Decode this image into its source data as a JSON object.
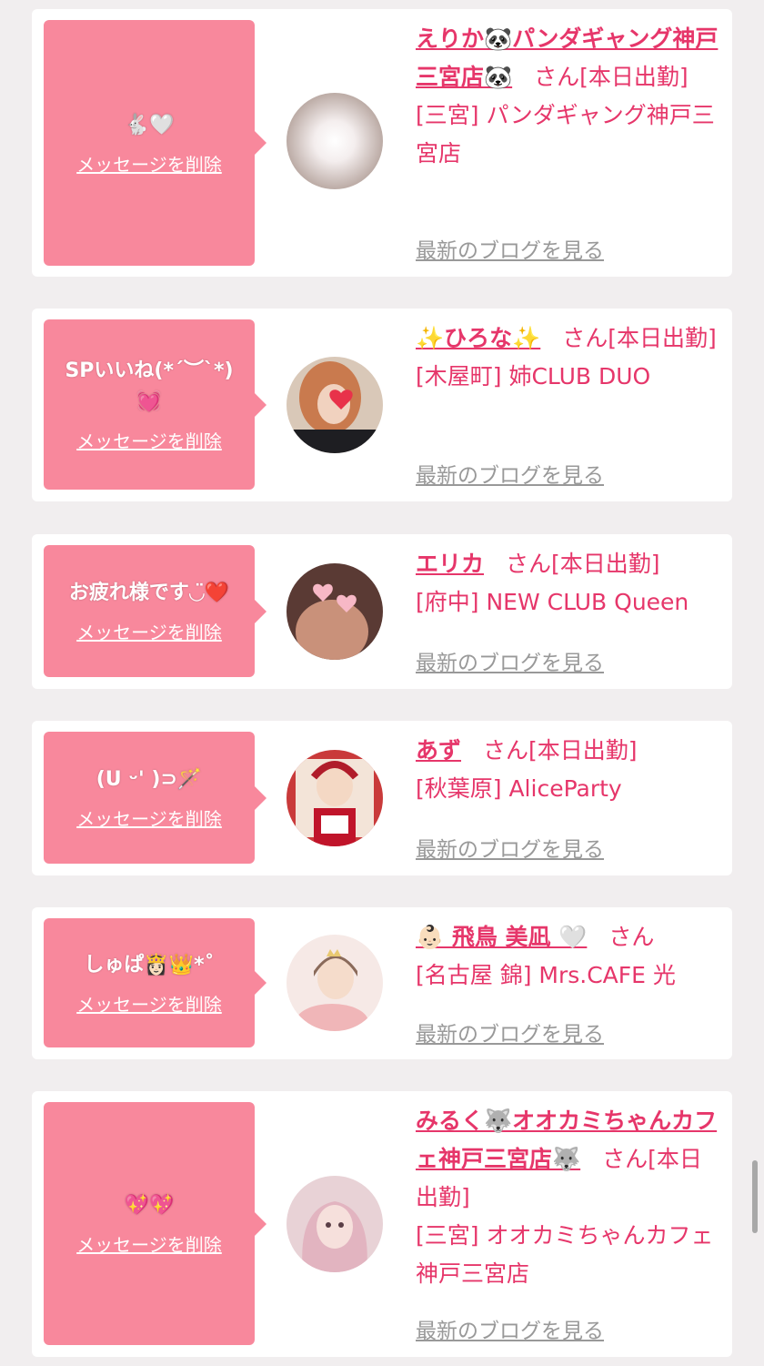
{
  "delete_label": "メッセージを削除",
  "blog_label": "最新のブログを見る",
  "colors": {
    "bubble": "#f8889c",
    "name": "#e6366a",
    "link": "#999999",
    "background": "#f1eeef"
  },
  "cards": [
    {
      "message": "🐇🤍",
      "name": "えりか🐼パンダギャング神戸三宮店🐼",
      "san": "さん",
      "status": "[本日出勤]",
      "shop": "[三宮] パンダギャング神戸三宮店",
      "avatar": "avatar-photo-1"
    },
    {
      "message": "SPいいね(*´︶`*)💓",
      "name": "✨ひろな✨",
      "san": "さん",
      "status": "[本日出勤]",
      "shop": "[木屋町] 姉CLUB DUO",
      "avatar": "avatar-photo-2"
    },
    {
      "message": "お疲れ様です◡̈❤️",
      "name": "エリカ",
      "san": "さん",
      "status": "[本日出勤]",
      "shop": "[府中] NEW CLUB Queen",
      "avatar": "avatar-photo-3"
    },
    {
      "message": "(U ᵕ' )⊃🪄",
      "name": "あず",
      "san": "さん",
      "status": "[本日出勤]",
      "shop": "[秋葉原] AliceParty",
      "avatar": "avatar-photo-4"
    },
    {
      "message": "しゅぱ👸🏻👑*˚",
      "name": "👶🏻 飛鳥 美凪 🤍",
      "san": "さん",
      "status": "",
      "shop": "[名古屋 錦] Mrs.CAFE 光",
      "avatar": "avatar-photo-5"
    },
    {
      "message": "💖💖",
      "name": "みるく🐺オオカミちゃんカフェ神戸三宮店🐺",
      "san": "さん",
      "status": "[本日出勤]",
      "shop": "[三宮] オオカミちゃんカフェ神戸三宮店",
      "avatar": "avatar-photo-6"
    }
  ]
}
